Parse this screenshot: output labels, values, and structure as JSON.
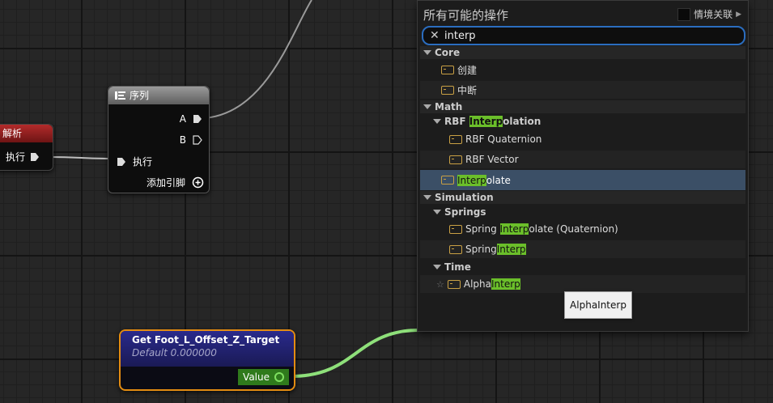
{
  "parse_node": {
    "title": "解析",
    "exec_label": "执行"
  },
  "sequence_node": {
    "title": "序列",
    "pin_a": "A",
    "pin_b": "B",
    "exec_label": "执行",
    "add_pin_label": "添加引脚"
  },
  "getter_node": {
    "title": "Get Foot_L_Offset_Z_Target",
    "subtitle": "Default 0.000000",
    "value_label": "Value"
  },
  "action_menu": {
    "title": "所有可能的操作",
    "context_sensitive_label": "情境关联",
    "search_value": "interp",
    "categories": {
      "core": "Core",
      "core_create": "创建",
      "core_break": "中断",
      "math": "Math",
      "rbf_pre": "RBF ",
      "rbf_hl": "Interp",
      "rbf_post": "olation",
      "rbf_quaternion": "RBF Quaternion",
      "rbf_vector": "RBF Vector",
      "interpolate_hl": "Interp",
      "interpolate_post": "olate",
      "simulation": "Simulation",
      "springs": "Springs",
      "spring_q_pre": "Spring ",
      "spring_q_hl": "Interp",
      "spring_q_post": "olate (Quaternion)",
      "spring_i_pre": "Spring",
      "spring_i_hl": "Interp",
      "time": "Time",
      "alpha_pre": "Alpha",
      "alpha_hl": "Interp"
    }
  },
  "tooltip": {
    "text": "AlphaInterp"
  },
  "colors": {
    "wire_data": "#8ee07a",
    "wire_exec": "#bdbdbd",
    "highlight": "#6bbf2a",
    "selected_row": "#3b4f66",
    "search_border": "#2b6dbf"
  }
}
